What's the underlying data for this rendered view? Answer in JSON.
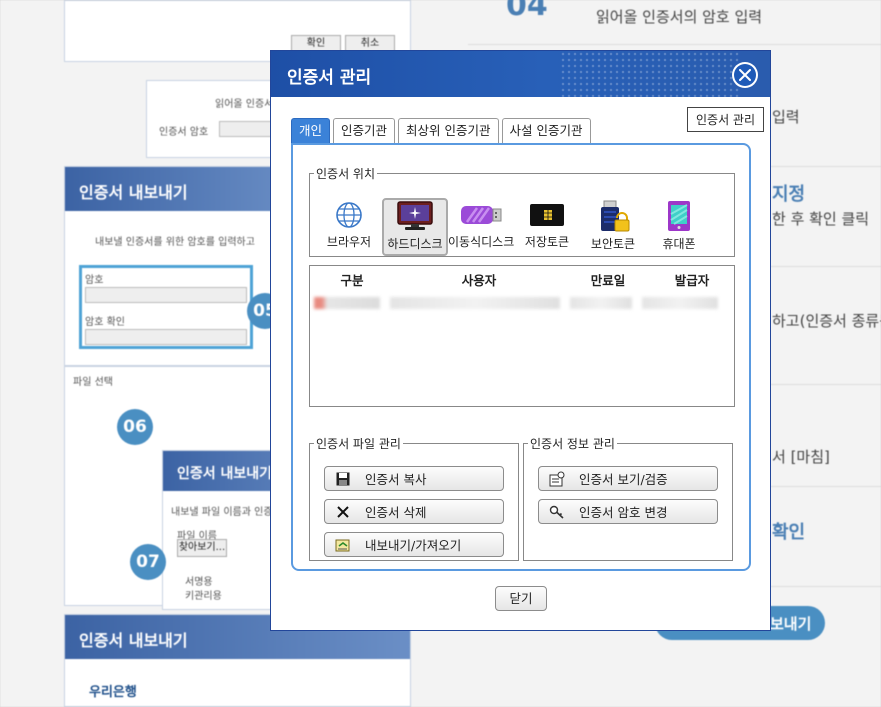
{
  "background": {
    "right_texts": [
      "읽어올 인증서의 암호 입력",
      "입력",
      "지정",
      "한 후 확인 클릭",
      "하고(인증서 종류는",
      "서 [마침]",
      "확인"
    ],
    "right_number": "04",
    "left_panel_titles": [
      "인증서 내보내기",
      "인증서 내보내기",
      "인증서 내보내기"
    ],
    "left_small": [
      "확인",
      "취소",
      "읽어올 인증서",
      "인증서 암호",
      "내보낼 인증서를 위한 암호를 입력하고",
      "암호",
      "암호 확인",
      "파일 선택",
      "파일 이름",
      "찾아보기...",
      "내보낼 파일 이름과 인증서",
      "서명용",
      "키관리용"
    ],
    "steps": [
      "05",
      "06",
      "07"
    ],
    "pill_label": "보내기",
    "bank_logo": "우리은행"
  },
  "dialog": {
    "title": "인증서 관리",
    "tooltip": "인증서 관리",
    "tabs": [
      "개인",
      "인증기관",
      "최상위 인증기관",
      "사설 인증기관"
    ],
    "location_legend": "인증서 위치",
    "locations": [
      {
        "label": "브라우저",
        "icon": "globe-icon"
      },
      {
        "label": "하드디스크",
        "icon": "monitor-icon"
      },
      {
        "label": "이동식디스크",
        "icon": "usb-drive-icon"
      },
      {
        "label": "저장토큰",
        "icon": "token-chip-icon"
      },
      {
        "label": "보안토큰",
        "icon": "security-token-icon"
      },
      {
        "label": "휴대폰",
        "icon": "phone-icon"
      }
    ],
    "selected_location": "하드디스크",
    "table": {
      "headers": [
        "구분",
        "사용자",
        "만료일",
        "발급자"
      ]
    },
    "file_mgmt": {
      "legend": "인증서 파일 관리",
      "buttons": [
        "인증서 복사",
        "인증서 삭제",
        "내보내기/가져오기"
      ]
    },
    "info_mgmt": {
      "legend": "인증서 정보 관리",
      "buttons": [
        "인증서 보기/검증",
        "인증서 암호 변경"
      ]
    },
    "close_label": "닫기",
    "colors": {
      "titlebar": "#1e4fa6",
      "active_tab": "#3b82d8",
      "content_border": "#5a9ae0"
    }
  }
}
